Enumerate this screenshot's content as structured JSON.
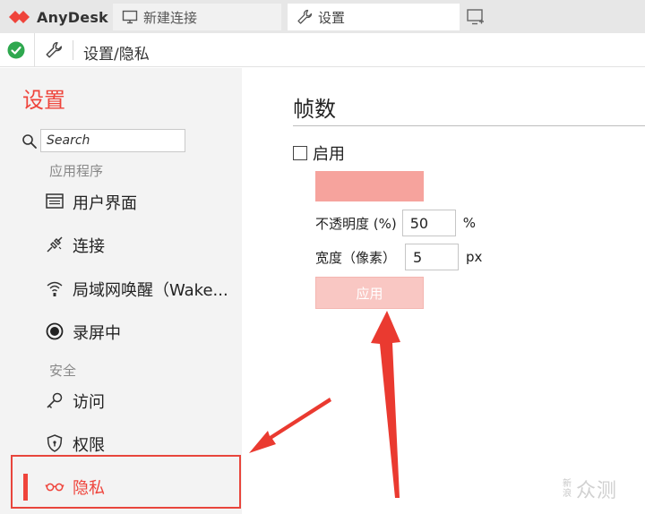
{
  "app": {
    "name": "AnyDesk",
    "colors": {
      "accent": "#ef443b",
      "swatch": "#f6a39d",
      "apply_bg": "#f9c7c3",
      "ok_green": "#2fa84f"
    }
  },
  "tabs": [
    {
      "label": "新建连接",
      "icon": "monitor-icon"
    },
    {
      "label": "设置",
      "icon": "wrench-icon"
    }
  ],
  "address": {
    "path": "设置/隐私",
    "status_icon": "connected-check-icon"
  },
  "sidebar": {
    "title": "设置",
    "search": {
      "placeholder": "Search",
      "value": ""
    },
    "sections": [
      {
        "label": "应用程序",
        "items": [
          {
            "label": "用户界面",
            "icon": "user-interface-icon"
          },
          {
            "label": "连接",
            "icon": "connection-plug-icon"
          },
          {
            "label": "局域网唤醒（Wake...",
            "icon": "wake-on-lan-icon"
          },
          {
            "label": "录屏中",
            "icon": "record-icon"
          }
        ]
      },
      {
        "label": "安全",
        "items": [
          {
            "label": "访问",
            "icon": "key-icon"
          },
          {
            "label": "权限",
            "icon": "shield-icon"
          },
          {
            "label": "隐私",
            "icon": "glasses-icon",
            "active": true
          }
        ]
      }
    ]
  },
  "main": {
    "section_title": "帧数",
    "enable": {
      "label": "启用",
      "checked": false
    },
    "opacity": {
      "label": "不透明度 (%)",
      "value": "50",
      "unit": "%"
    },
    "width": {
      "label": "宽度（像素）",
      "value": "5",
      "unit": "px"
    },
    "apply_label": "应用"
  },
  "watermark": {
    "small": [
      "新",
      "浪"
    ],
    "main": "众测"
  }
}
